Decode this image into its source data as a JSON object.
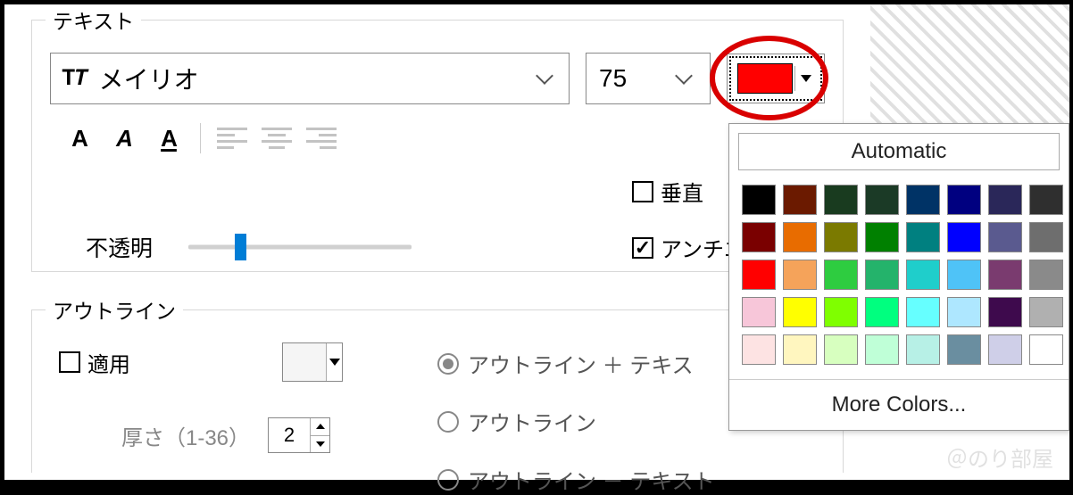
{
  "text_section": {
    "legend": "テキスト",
    "font_name": "メイリオ",
    "font_size": "75",
    "selected_color": "#ff0000",
    "bold": "A",
    "italic": "A",
    "underline": "A",
    "vertical_label": "垂直",
    "antialias_label": "アンチエ",
    "opacity_label": "不透明"
  },
  "outline_section": {
    "legend": "アウトライン",
    "apply_label": "適用",
    "thickness_label": "厚さ（1-36）",
    "thickness_value": "2",
    "modes": {
      "outline_plus_text": "アウトライン ＋ テキス",
      "outline_only": "アウトライン",
      "outline_minus_text": "アウトライン － テキスト"
    }
  },
  "color_picker": {
    "automatic": "Automatic",
    "more": "More Colors...",
    "swatches": [
      "#000000",
      "#6b1a00",
      "#193b1f",
      "#1b3a26",
      "#003366",
      "#000080",
      "#2a2759",
      "#2f2f2f",
      "#7a0000",
      "#e86c00",
      "#7b7a00",
      "#008000",
      "#008080",
      "#0000ff",
      "#5a5a8f",
      "#6e6e6e",
      "#ff0000",
      "#f5a35a",
      "#2ecc40",
      "#24b36b",
      "#1fcecb",
      "#4fc3f7",
      "#7a3b6f",
      "#8a8a8a",
      "#f7c6d9",
      "#ffff00",
      "#7fff00",
      "#00ff7f",
      "#66ffff",
      "#aee7ff",
      "#3e0a4d",
      "#b0b0b0",
      "#fde3e3",
      "#fff6bf",
      "#d7ffbf",
      "#bfffd7",
      "#b7f0e6",
      "#6a8ea0",
      "#cfcfe8",
      "#ffffff"
    ]
  },
  "watermark": "＠のり部屋"
}
